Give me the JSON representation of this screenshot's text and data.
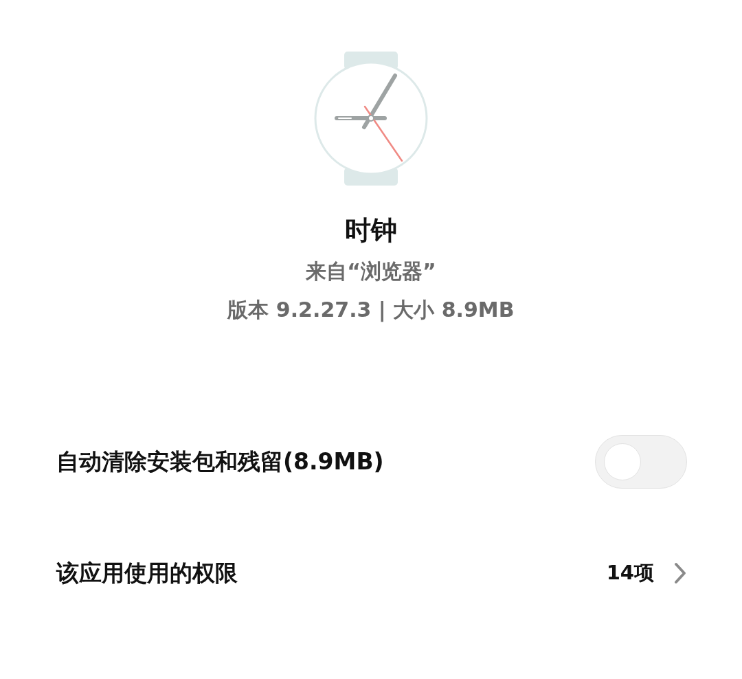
{
  "app": {
    "name": "时钟",
    "source": "来自“浏览器”",
    "info": "版本 9.2.27.3 | 大小 8.9MB"
  },
  "rows": [
    {
      "kind": "toggle",
      "label": "自动清除安装包和残留(8.9MB)",
      "on": false
    },
    {
      "kind": "link",
      "label": "该应用使用的权限",
      "value": "14项"
    }
  ]
}
